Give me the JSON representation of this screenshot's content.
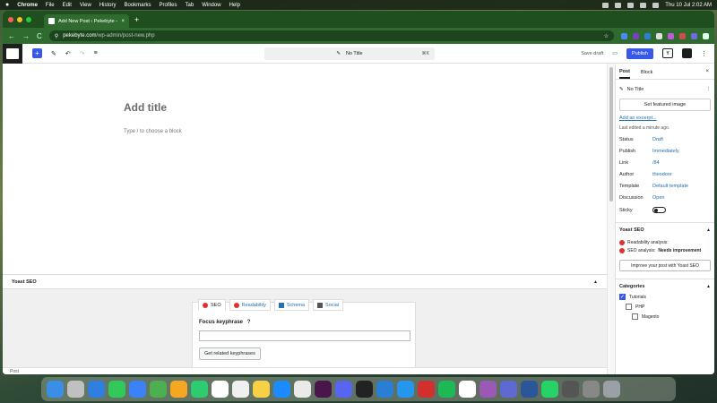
{
  "menubar": {
    "apple": "",
    "items": [
      "Chrome",
      "File",
      "Edit",
      "View",
      "History",
      "Bookmarks",
      "Profiles",
      "Tab",
      "Window",
      "Help"
    ],
    "clock": "Thu 10 Jul  2:02 AM"
  },
  "browser": {
    "tab_title": "Add New Post ‹ Pekebyte — WordPress",
    "url_host": "pekebyte.com",
    "url_path": "/wp-admin/post-new.php",
    "back": "←",
    "forward": "→",
    "reload": "C",
    "star": "☆"
  },
  "toolbar": {
    "add": "+",
    "pen": "✎",
    "undo": "↶",
    "redo": "↷",
    "list": "≡",
    "doc_title": "No Title",
    "doc_icon": "✎",
    "shortcut": "⌘K",
    "save_draft": "Save draft",
    "publish": "Publish",
    "yoast": "Y",
    "more": "⋮",
    "preview": "▭"
  },
  "canvas": {
    "title_placeholder": "Add title",
    "block_hint": "Type / to choose a block"
  },
  "yoast_box": {
    "title": "Yoast SEO",
    "caret": "▲",
    "tabs": [
      "SEO",
      "Readability",
      "Schema",
      "Social"
    ],
    "focus_label": "Focus keyphrase",
    "help": "?",
    "related_btn": "Get related keyphrases"
  },
  "sidebar": {
    "tab_post": "Post",
    "tab_block": "Block",
    "close": "×",
    "post_title": "No Title",
    "more": "⋮",
    "featured_btn": "Set featured image",
    "excerpt_link": "Add an excerpt...",
    "last_edited": "Last edited a minute ago.",
    "rows": [
      {
        "k": "Status",
        "v": "Draft"
      },
      {
        "k": "Publish",
        "v": "Immediately"
      },
      {
        "k": "Link",
        "v": "/84"
      },
      {
        "k": "Author",
        "v": "theodore"
      },
      {
        "k": "Template",
        "v": "Default template"
      },
      {
        "k": "Discussion",
        "v": "Open"
      }
    ],
    "sticky": "Sticky",
    "yoast_title": "Yoast SEO",
    "readability": "Readability analysis:",
    "seo_analysis": "SEO analysis:",
    "seo_status": "Needs improvement",
    "improve_btn": "Improve your post with Yoast SEO",
    "categories_title": "Categories",
    "categories": [
      {
        "label": "Tutorials",
        "checked": true,
        "level": 0
      },
      {
        "label": "PHP",
        "checked": false,
        "level": 1
      },
      {
        "label": "Magento",
        "checked": false,
        "level": 2
      }
    ],
    "caret": "▲"
  },
  "footer": {
    "breadcrumb": "Post"
  },
  "colors": {
    "wp_blue": "#3858e9",
    "chrome_green": "#2f6a2f",
    "link": "#2271b1",
    "yoast_red": "#dc3232"
  },
  "dock_icons": [
    "finder",
    "launchpad",
    "safari",
    "messages",
    "mail",
    "maps",
    "photos",
    "facetime",
    "calendar",
    "reminders",
    "notes",
    "app-store",
    "chrome",
    "slack",
    "discord",
    "terminal",
    "vscode",
    "docker",
    "filezilla",
    "spotify",
    "notion",
    "podcasts",
    "linear",
    "word",
    "whatsapp",
    "calculator",
    "settings",
    "trash"
  ]
}
